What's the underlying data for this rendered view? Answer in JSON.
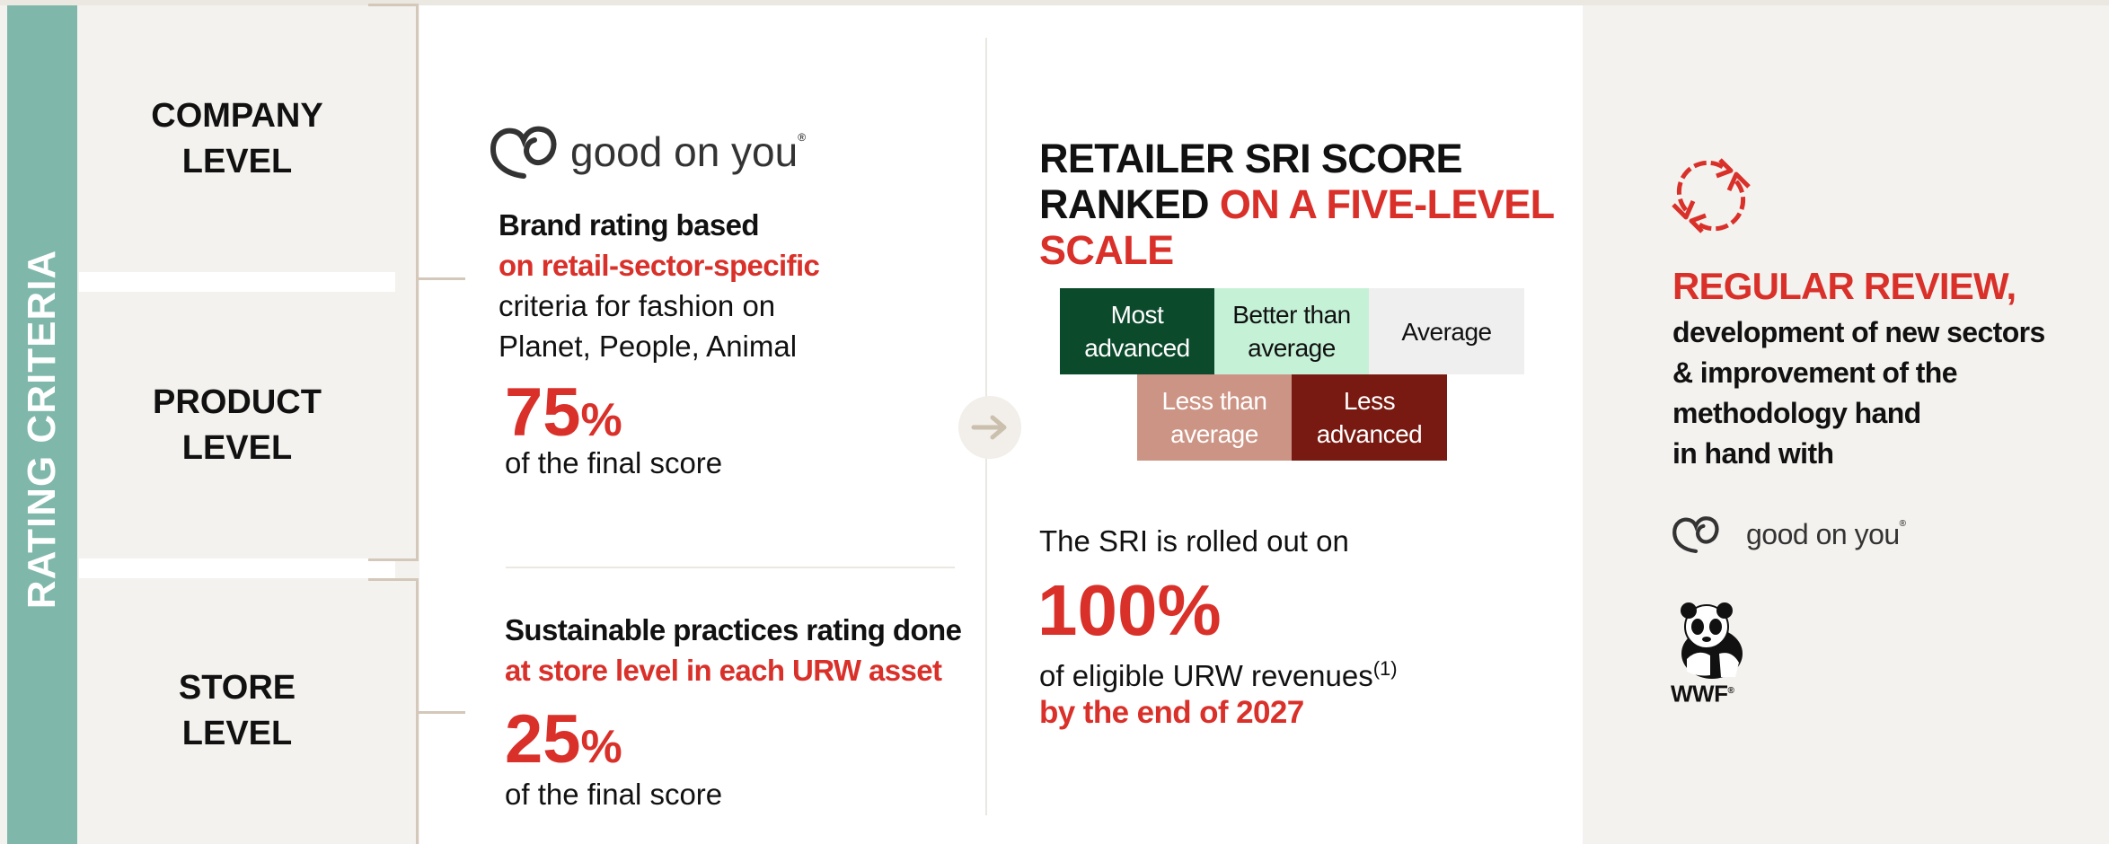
{
  "sidebar": {
    "label": "RATING CRITERIA",
    "color": "#7fb8aa"
  },
  "levels": {
    "company": "COMPANY\nLEVEL",
    "product": "PRODUCT\nLEVEL",
    "store": "STORE\nLEVEL"
  },
  "brand_block": {
    "logo_text": "good on you",
    "logo_mark": "®",
    "line1": "Brand rating based",
    "line2": " on retail-sector-specific",
    "line3": "criteria for fashion on",
    "line4": "Planet, People, Animal",
    "pct_value": "75",
    "pct_sign": "%",
    "pct_caption": "of the final score"
  },
  "store_block": {
    "line1": "Sustainable practices rating done",
    "line2": "at store level in each URW asset",
    "pct_value": "25",
    "pct_sign": "%",
    "pct_caption": "of the final score"
  },
  "sri_block": {
    "title_line1": "RETAILER SRI SCORE",
    "title_line2a": "RANKED ",
    "title_line2b": "ON A FIVE-LEVEL",
    "title_line3": "SCALE",
    "scale": [
      {
        "label": "Most\nadvanced",
        "bg": "#0c4a2c",
        "fg": "#ffffff"
      },
      {
        "label": "Better than\naverage",
        "bg": "#c5f1d7",
        "fg": "#111111"
      },
      {
        "label": "Average",
        "bg": "#efefef",
        "fg": "#111111"
      },
      {
        "label": "Less than\naverage",
        "bg": "#cc9484",
        "fg": "#ffffff"
      },
      {
        "label": "Less\nadvanced",
        "bg": "#781a12",
        "fg": "#ffffff"
      }
    ],
    "rollout_intro": "The SRI is rolled out on",
    "rollout_value": "100%",
    "rollout_caption": "of eligible URW revenues",
    "rollout_footnote": "(1)",
    "rollout_deadline": "by the end of 2027"
  },
  "review_block": {
    "title": "REGULAR REVIEW,",
    "body": "development of new sectors\n& improvement of the\nmethodology hand\nin hand with",
    "partner1_text": "good on you",
    "partner1_mark": "®",
    "partner2_text": "WWF",
    "partner2_mark": "®"
  },
  "icons": [
    "refresh-cycle-icon",
    "arrow-right-icon",
    "good-on-you-heart-icon",
    "wwf-panda-icon"
  ],
  "colors": {
    "accent_red": "#d9302a",
    "teal": "#7fb8aa",
    "beige": "#f4f2ee",
    "bracket": "#d3c8b9"
  }
}
